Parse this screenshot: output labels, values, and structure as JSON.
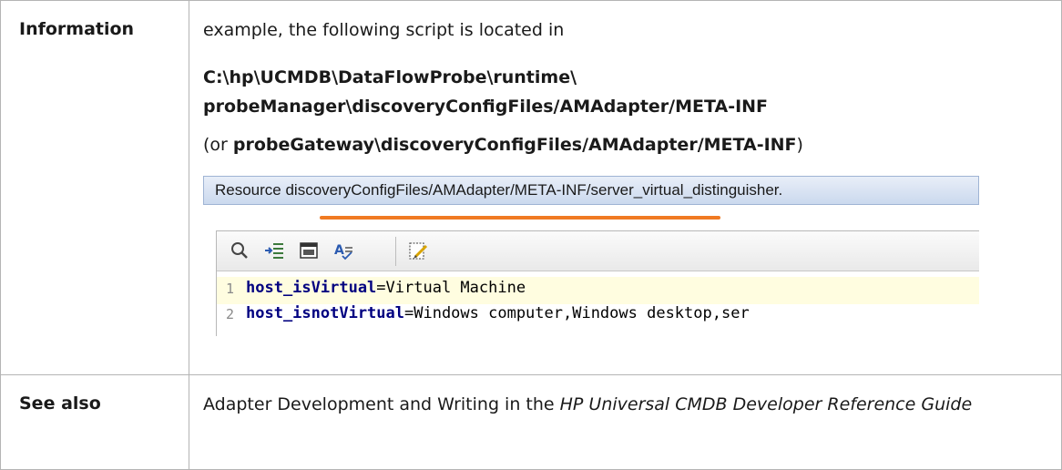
{
  "rows": {
    "information": {
      "label": "Information",
      "intro": "example, the following script is located in",
      "path_line1": "C:\\hp\\UCMDB\\DataFlowProbe\\runtime\\",
      "path_line2": "probeManager\\discoveryConfigFiles/AMAdapter/META-INF",
      "alt_prefix": "(or ",
      "alt_path": "probeGateway\\discoveryConfigFiles/AMAdapter/META-INF",
      "alt_suffix": ")"
    },
    "see_also": {
      "label": "See also",
      "text_plain": "Adapter Development and Writing in the ",
      "text_italic": "HP Universal CMDB Developer Reference Guide"
    }
  },
  "screenshot": {
    "title": "Resource discoveryConfigFiles/AMAdapter/META-INF/server_virtual_distinguisher.",
    "underline_color": "#f07a22",
    "toolbar_icons": [
      "search-icon",
      "indent-icon",
      "window-icon",
      "spell-check-icon",
      "edit-note-icon"
    ],
    "code": [
      {
        "line_no": "1",
        "key": "host_isVirtual",
        "rest": "=Virtual Machine"
      },
      {
        "line_no": "2",
        "key": "host_isnotVirtual",
        "rest": "=Windows computer,Windows desktop,ser"
      }
    ]
  }
}
